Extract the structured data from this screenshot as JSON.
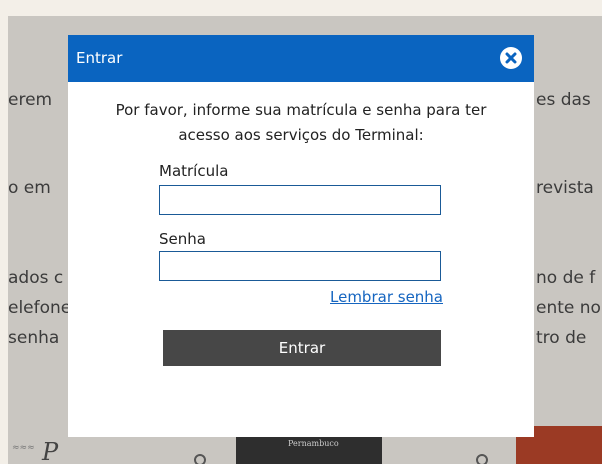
{
  "background": {
    "left_fragments": [
      "erem ",
      "o em",
      "ados c",
      "elefone",
      "senha"
    ],
    "right_fragments": [
      "es das",
      "revista",
      "no de f",
      "ente no",
      "tro de"
    ],
    "thumb_text": "Pernambuco"
  },
  "modal": {
    "title": "Entrar",
    "intro": "Por favor, informe sua matrícula e senha para ter acesso aos serviços do Terminal:",
    "matricula_label": "Matrícula",
    "matricula_value": "",
    "senha_label": "Senha",
    "senha_value": "",
    "remember_link": "Lembrar senha",
    "submit_label": "Entrar"
  },
  "colors": {
    "header": "#0a64c0",
    "button": "#474747",
    "link": "#1565c0"
  }
}
